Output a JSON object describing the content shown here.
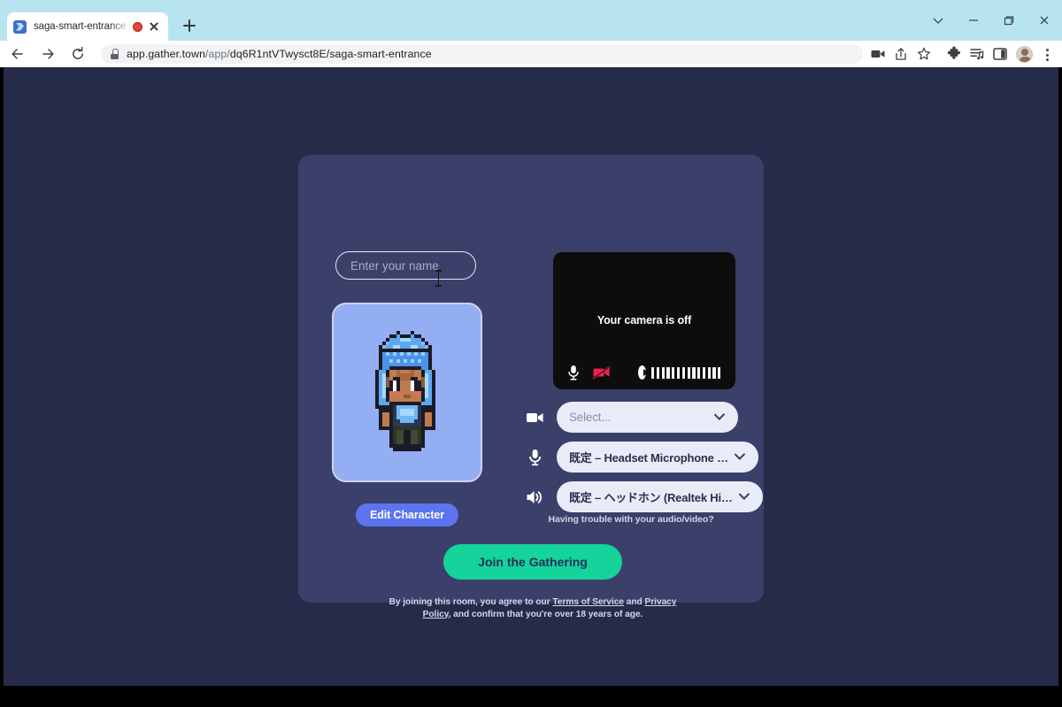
{
  "browser": {
    "tab": {
      "title": "saga-smart-entrance | Gathe",
      "favicon": "gather-favicon",
      "recording_indicator": "recording-dot",
      "close": "close-icon"
    },
    "new_tab_label": "+",
    "window_controls": [
      "chevron-down-icon",
      "minimize-icon",
      "restore-icon",
      "close-icon"
    ],
    "nav": {
      "back": "back-arrow-icon",
      "forward": "forward-arrow-icon",
      "reload": "reload-icon"
    },
    "omnibox": {
      "lock": "lock-icon",
      "url_host": "app.gather.town",
      "url_path_dim": "/app/",
      "url_id": "dq6R1ntVTwysct8E",
      "url_tail": "/saga-smart-entrance",
      "full_url": "app.gather.town/app/dq6R1ntVTwysct8E/saga-smart-entrance"
    },
    "toolbar_icons": [
      "screencast-icon",
      "share-icon",
      "bookmark-star-icon",
      "extensions-puzzle-icon",
      "reading-list-icon",
      "side-panel-icon"
    ],
    "profile": "profile-avatar",
    "menu": "three-dot-menu-icon"
  },
  "page": {
    "background_color": "#272b4a",
    "card_color": "#3b406a",
    "name_field": {
      "value": "",
      "placeholder": "Enter your name"
    },
    "avatar": {
      "frame_color": "#93aef2",
      "description": "pixel-art-character"
    },
    "edit_character_label": "Edit Character",
    "camera": {
      "status_text": "Your camera is off",
      "mic_icon": "microphone-icon",
      "camera_off_icon": "camera-off-icon",
      "camera_off_color": "#e8234f",
      "play_icon": "play-icon",
      "level_bars": 14
    },
    "devices": [
      {
        "icon": "video-camera-icon",
        "value": "Select...",
        "is_placeholder": true
      },
      {
        "icon": "microphone-icon",
        "value": "既定 – Headset Microphone …",
        "is_placeholder": false
      },
      {
        "icon": "speaker-icon",
        "value": "既定 – ヘッドホン (Realtek Hi…",
        "is_placeholder": false
      }
    ],
    "trouble_link": "Having trouble with your audio/video?",
    "join_button": {
      "label": "Join the Gathering",
      "color": "#14d39b"
    },
    "legal": {
      "line1_a": "By joining this room, you agree to our ",
      "line1_link": "Terms of Service",
      "line1_b": " and",
      "line2_link": "Privacy Policy",
      "line2_b": ", and confirm that you're over 18 years of age."
    }
  }
}
